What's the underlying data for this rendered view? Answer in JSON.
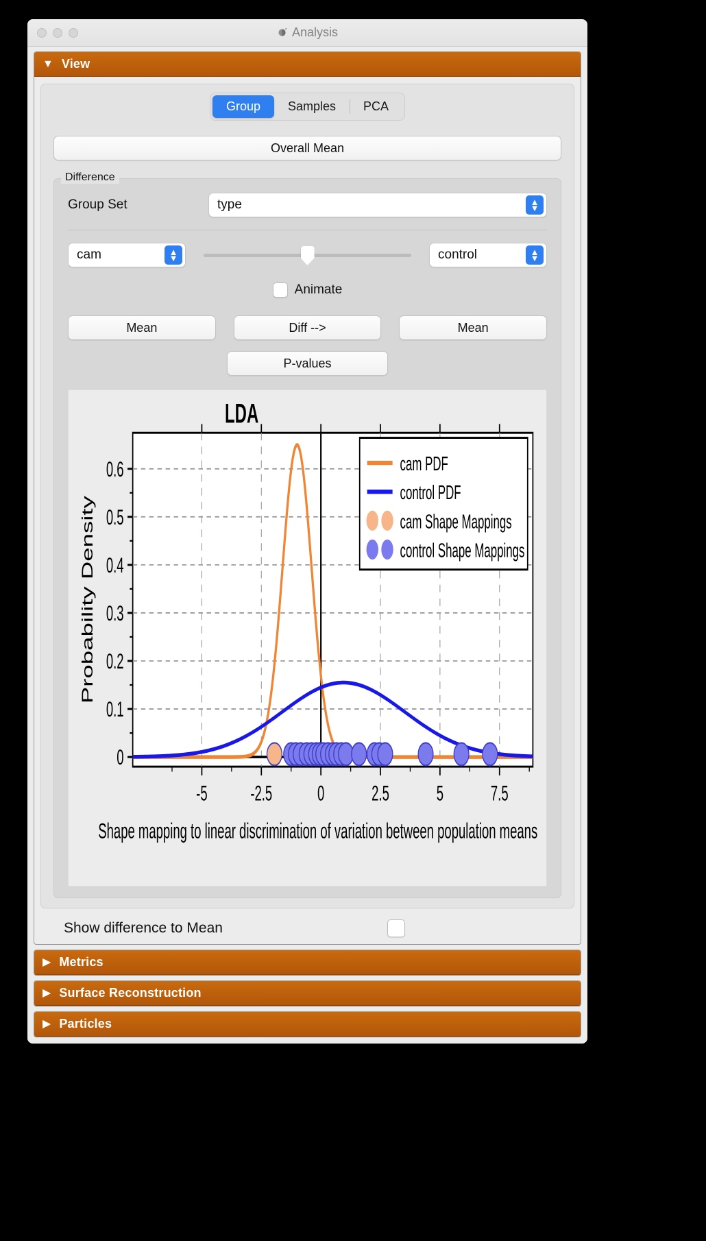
{
  "window": {
    "title": "Analysis",
    "app_icon": "app-icon"
  },
  "accordions": [
    {
      "id": "view",
      "title": "View",
      "expanded": true,
      "arrow": "▼"
    },
    {
      "id": "metrics",
      "title": "Metrics",
      "expanded": false,
      "arrow": "▶"
    },
    {
      "id": "surface",
      "title": "Surface Reconstruction",
      "expanded": false,
      "arrow": "▶"
    },
    {
      "id": "particles",
      "title": "Particles",
      "expanded": false,
      "arrow": "▶"
    }
  ],
  "tabs": [
    {
      "label": "Group",
      "active": true
    },
    {
      "label": "Samples",
      "active": false
    },
    {
      "label": "PCA",
      "active": false
    }
  ],
  "overall_mean_button": "Overall Mean",
  "difference": {
    "legend": "Difference",
    "group_set_label": "Group Set",
    "group_set_value": "type",
    "left_group_value": "cam",
    "right_group_value": "control",
    "slider_value": 50,
    "animate_label": "Animate",
    "animate_checked": false,
    "buttons": {
      "left_mean": "Mean",
      "diff": "Diff -->",
      "right_mean": "Mean",
      "p_values": "P-values"
    }
  },
  "show_difference": {
    "label": "Show difference to Mean",
    "checked": false
  },
  "colors": {
    "accent_header": "#bf5f0b",
    "tab_active": "#2f7ff0",
    "cam_orange": "#ef8636",
    "control_blue": "#1818e8",
    "cam_dot": "#f7b58a",
    "control_dot": "#7b7bee"
  },
  "chart_data": {
    "type": "line",
    "title": "LDA",
    "xlabel": "Shape mapping to linear discrimination of variation between population means",
    "ylabel": "Probability Density",
    "xlim": [
      -7.9,
      8.9
    ],
    "ylim": [
      -0.02,
      0.675
    ],
    "xticks": [
      -5,
      -2.5,
      0,
      2.5,
      5,
      7.5
    ],
    "xticklabels": [
      "-5",
      "-2.5",
      "0",
      "2.5",
      "5",
      "7.5"
    ],
    "yticks": [
      0,
      0.1,
      0.2,
      0.3,
      0.4,
      0.5,
      0.6
    ],
    "yticklabels": [
      "0",
      "0.1",
      "0.2",
      "0.3",
      "0.4",
      "0.5",
      "0.6"
    ],
    "grid": true,
    "legend_position": "upper right",
    "legend": [
      {
        "label": "cam PDF",
        "marker": "line",
        "color": "#ef8636"
      },
      {
        "label": "control PDF",
        "marker": "line",
        "color": "#1818e8"
      },
      {
        "label": "cam Shape Mappings",
        "marker": "dots",
        "color": "#f7b58a"
      },
      {
        "label": "control Shape Mappings",
        "marker": "dots",
        "color": "#7b7bee"
      }
    ],
    "series": [
      {
        "name": "cam PDF",
        "color": "#ef8636",
        "kind": "gaussian",
        "mean": -1.0,
        "sigma": 0.61,
        "peak": 0.65
      },
      {
        "name": "control PDF",
        "color": "#1818e8",
        "kind": "gaussian",
        "mean": 0.95,
        "sigma": 2.57,
        "peak": 0.155
      }
    ],
    "scatter": [
      {
        "name": "cam Shape Mappings",
        "color": "#f7b58a",
        "y": 0.006,
        "x": [
          -1.95
        ]
      },
      {
        "name": "control Shape Mappings",
        "color": "#7b7bee",
        "y": 0.006,
        "x": [
          -1.25,
          -1.05,
          -0.85,
          -0.6,
          -0.4,
          -0.2,
          -0.05,
          0.1,
          0.3,
          0.5,
          0.65,
          0.85,
          1.05,
          1.6,
          2.25,
          2.45,
          2.7,
          4.4,
          5.9,
          7.1
        ]
      }
    ],
    "vline_x": 0,
    "baseline_y": 0
  }
}
